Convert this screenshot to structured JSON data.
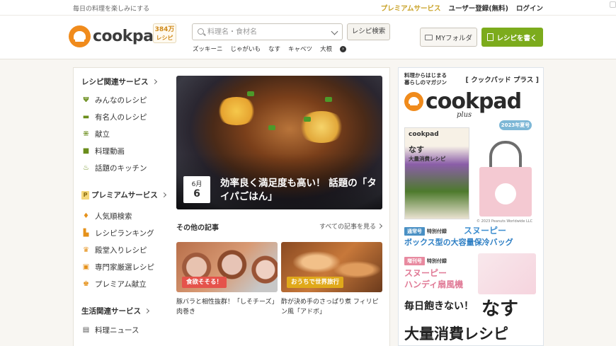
{
  "topbar": {
    "tagline": "毎日の料理を楽しみにする",
    "links": [
      "プレミアムサービス",
      "ユーザー登録(無料)",
      "ログイン"
    ]
  },
  "header": {
    "logo_text": "cookpad",
    "recipe_count": "384万",
    "recipe_count_label": "レシピ",
    "search_placeholder": "料理名・食材名",
    "search_button": "レシピ検索",
    "keywords": [
      "ズッキーニ",
      "じゃがいも",
      "なす",
      "キャベツ",
      "大根"
    ],
    "my_folder": "MYフォルダ",
    "write_recipe": "レシピを書く"
  },
  "sidebar": {
    "sections": [
      {
        "title": "レシピ関連サービス",
        "items": [
          {
            "label": "みんなのレシピ",
            "icon": "fork-knife-icon"
          },
          {
            "label": "有名人のレシピ",
            "icon": "book-icon"
          },
          {
            "label": "献立",
            "icon": "menu-icon"
          },
          {
            "label": "料理動画",
            "icon": "video-icon"
          },
          {
            "label": "話題のキッチン",
            "icon": "pot-icon"
          }
        ]
      },
      {
        "title": "プレミアムサービス",
        "badge": "P",
        "items": [
          {
            "label": "人気順検索",
            "icon": "thumbs-up-icon"
          },
          {
            "label": "レシピランキング",
            "icon": "ranking-icon"
          },
          {
            "label": "殿堂入りレシピ",
            "icon": "trophy-icon"
          },
          {
            "label": "専門家厳選レシピ",
            "icon": "chef-icon"
          },
          {
            "label": "プレミアム献立",
            "icon": "crown-icon"
          }
        ]
      },
      {
        "title": "生活関連サービス",
        "items": [
          {
            "label": "料理ニュース",
            "icon": "news-icon"
          }
        ]
      }
    ]
  },
  "feature": {
    "month": "6月",
    "day": "6",
    "title": "効率良く満足度も高い！ 話題の「タイパごはん」"
  },
  "articles": {
    "heading": "その他の記事",
    "see_all": "すべての記事を見る",
    "items": [
      {
        "tag": "食欲そそる！",
        "title": "豚バラと相性抜群！「しそチーズ」肉巻き"
      },
      {
        "tag": "おうちで世界旅行",
        "title": "酢が決め手のさっぱり煮 フィリピン風「アドボ」"
      }
    ]
  },
  "ad": {
    "subtitle_line1": "料理からはじまる",
    "subtitle_line2": "暮らしのマガジン",
    "brand_jp": "[ クックパッド プラス ]",
    "logo": "cookpad",
    "logo_plus": "plus",
    "year_badge": "2023年夏号",
    "mag_logo": "cookpad",
    "mag_title": "なす",
    "mag_sub": "大量消費レシピ",
    "copyright": "© 2023 Peanuts Worldwide LLC",
    "tag1": "通常号",
    "tag1_note": "特別付録",
    "snoopy1": "スヌーピー",
    "line1": "ボックス型の大容量保冷バッグ",
    "tag2": "増刊号",
    "tag2_note": "特別付録",
    "snoopy2": "スヌーピー",
    "line2": "ハンディ扇風機",
    "foot1": "毎日飽きない！",
    "foot_big": "なす",
    "foot2": "大量消費レシピ"
  }
}
